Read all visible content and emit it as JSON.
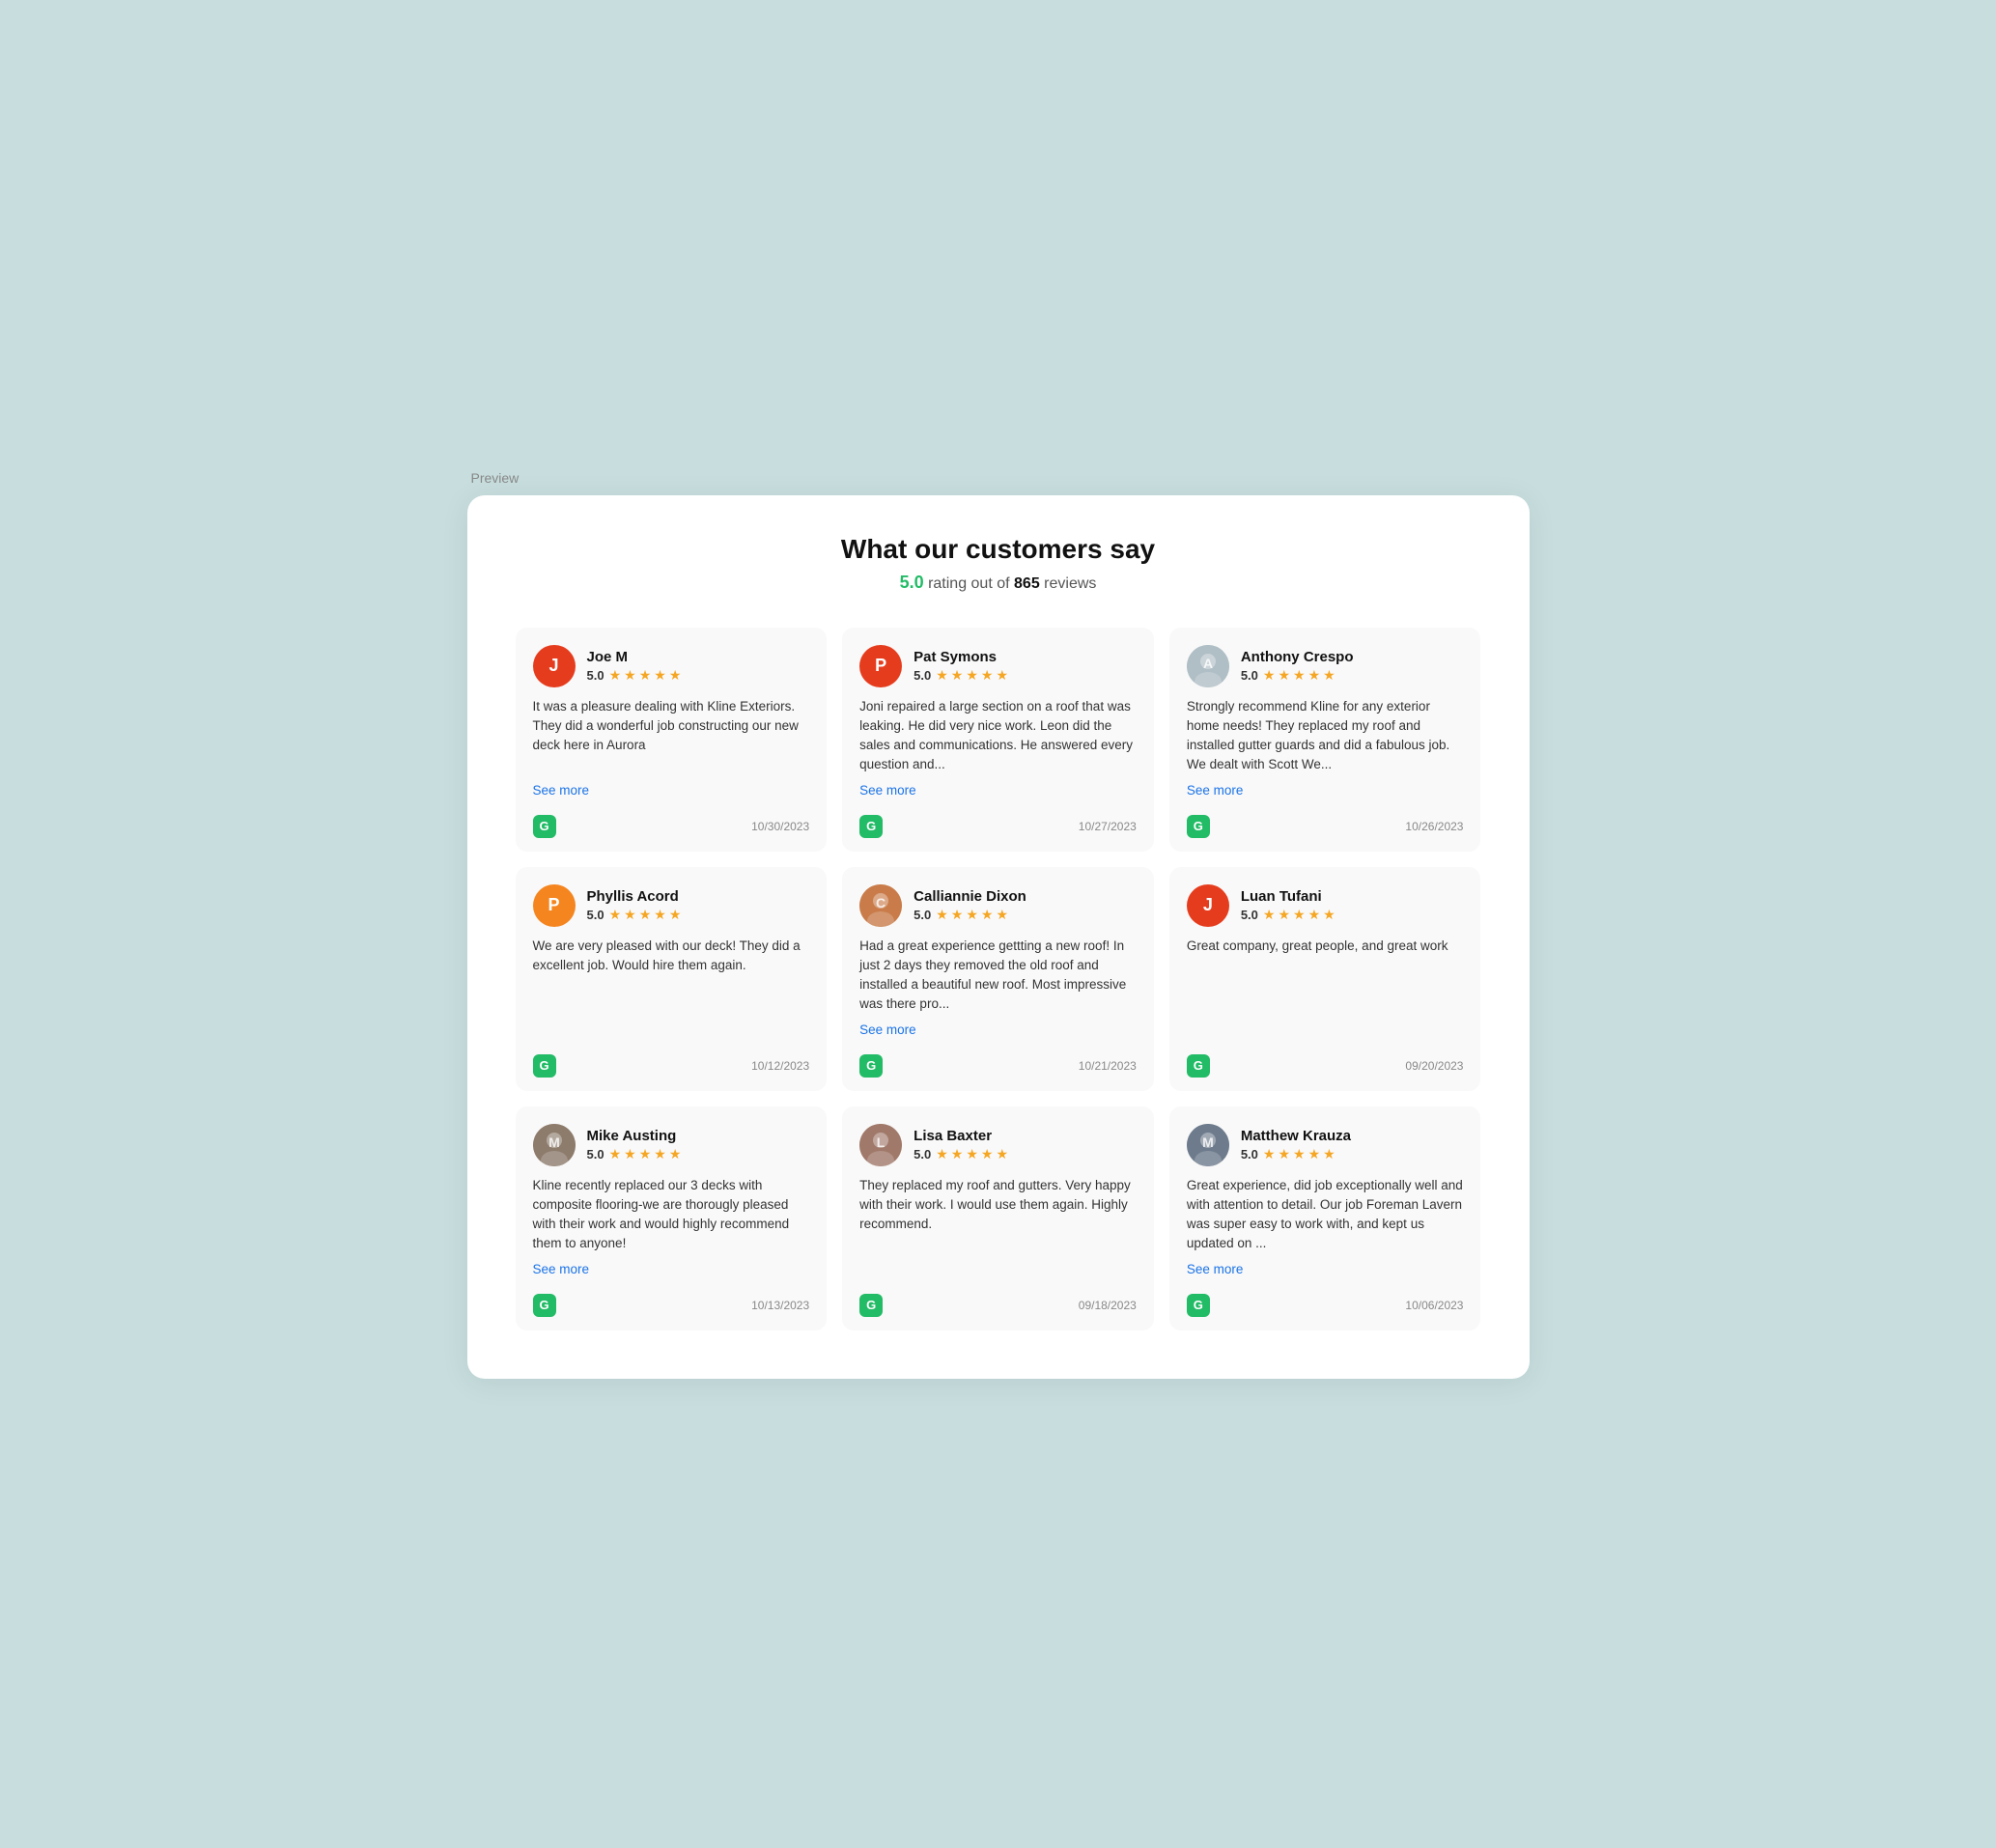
{
  "preview_label": "Preview",
  "header": {
    "title": "What our customers say",
    "rating": "5.0",
    "rating_text": "rating out of",
    "review_count": "865",
    "review_suffix": "reviews"
  },
  "reviews": [
    {
      "id": 1,
      "name": "Joe M",
      "avatar_letter": "J",
      "avatar_type": "letter",
      "avatar_color": "red",
      "rating": "5.0",
      "text": "It was a pleasure dealing with Kline Exteriors. They did a wonderful job constructing our new deck here in Aurora",
      "has_see_more": true,
      "date": "10/30/2023"
    },
    {
      "id": 2,
      "name": "Pat Symons",
      "avatar_letter": "P",
      "avatar_type": "letter",
      "avatar_color": "red",
      "rating": "5.0",
      "text": "Joni repaired a large section on a roof that was leaking. He did very nice work. Leon did the sales and communications. He answered every question and...",
      "has_see_more": true,
      "date": "10/27/2023"
    },
    {
      "id": 3,
      "name": "Anthony Crespo",
      "avatar_letter": "A",
      "avatar_type": "photo",
      "avatar_color": "gray",
      "rating": "5.0",
      "text": "Strongly recommend Kline for any exterior home needs! They replaced my roof and installed gutter guards and did a fabulous job. We dealt with Scott We...",
      "has_see_more": true,
      "date": "10/26/2023"
    },
    {
      "id": 4,
      "name": "Phyllis Acord",
      "avatar_letter": "P",
      "avatar_type": "letter",
      "avatar_color": "orange",
      "rating": "5.0",
      "text": "We are very pleased with our deck! They did a excellent job. Would hire them again.",
      "has_see_more": false,
      "date": "10/12/2023"
    },
    {
      "id": 5,
      "name": "Calliannie Dixon",
      "avatar_letter": "C",
      "avatar_type": "photo",
      "avatar_color": "orange",
      "rating": "5.0",
      "text": "Had a great experience gettting a new roof! In just 2 days they removed the old roof and installed a beautiful new roof. Most impressive was there pro...",
      "has_see_more": true,
      "date": "10/21/2023"
    },
    {
      "id": 6,
      "name": "Luan Tufani",
      "avatar_letter": "J",
      "avatar_type": "letter",
      "avatar_color": "red",
      "rating": "5.0",
      "text": "Great company, great people, and great work",
      "has_see_more": false,
      "date": "09/20/2023"
    },
    {
      "id": 7,
      "name": "Mike Austing",
      "avatar_letter": "M",
      "avatar_type": "photo",
      "avatar_color": "gray",
      "rating": "5.0",
      "text": "Kline recently replaced our 3 decks with composite flooring-we are thorougly pleased with their work and would highly recommend them to anyone!",
      "has_see_more": true,
      "date": "10/13/2023"
    },
    {
      "id": 8,
      "name": "Lisa Baxter",
      "avatar_letter": "L",
      "avatar_type": "photo",
      "avatar_color": "orange",
      "rating": "5.0",
      "text": "They replaced my roof and gutters. Very happy with their work. I would use them again. Highly recommend.",
      "has_see_more": false,
      "date": "09/18/2023"
    },
    {
      "id": 9,
      "name": "Matthew Krauza",
      "avatar_letter": "M",
      "avatar_type": "photo",
      "avatar_color": "gray",
      "rating": "5.0",
      "text": "Great experience, did job exceptionally well and with attention to detail. Our job Foreman Lavern was super easy to work with, and kept us updated on ...",
      "has_see_more": true,
      "date": "10/06/2023"
    }
  ],
  "see_more_label": "See more",
  "platform_icon": "G",
  "stars_count": 5
}
